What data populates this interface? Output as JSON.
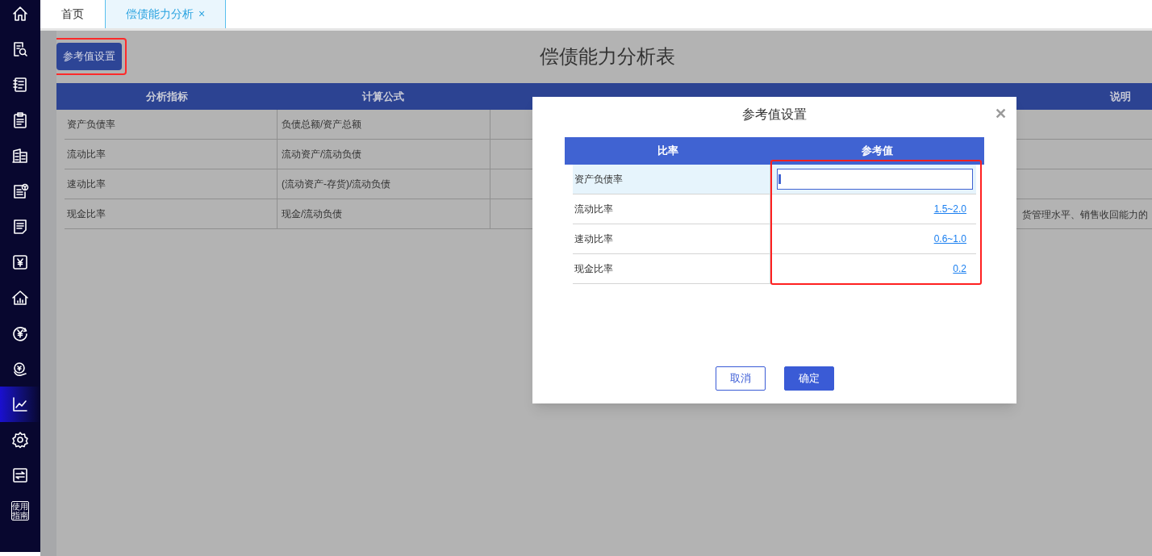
{
  "sidebar": {
    "items": [
      {
        "kind": "home",
        "selected": false
      },
      {
        "kind": "doc-search",
        "selected": false
      },
      {
        "kind": "list",
        "selected": false
      },
      {
        "kind": "clipboard",
        "selected": false
      },
      {
        "kind": "building",
        "selected": false
      },
      {
        "kind": "doc-yen",
        "selected": false
      },
      {
        "kind": "document",
        "selected": false
      },
      {
        "kind": "yen-square",
        "selected": false
      },
      {
        "kind": "house",
        "selected": false
      },
      {
        "kind": "yen-circle",
        "selected": false
      },
      {
        "kind": "coin",
        "selected": false
      },
      {
        "kind": "chart",
        "selected": true
      },
      {
        "kind": "gear",
        "selected": false
      },
      {
        "kind": "exchange",
        "selected": false
      },
      {
        "kind": "guide",
        "selected": false,
        "label": "使用指南"
      }
    ]
  },
  "tabs": [
    {
      "label": "首页",
      "selected": false
    },
    {
      "label": "偿债能力分析",
      "selected": true,
      "close": "×"
    }
  ],
  "toolbar": {
    "button": "参考值设置",
    "highlighted": true
  },
  "page_title": "偿债能力分析表",
  "table": {
    "columns": [
      "分析指标",
      "计算公式",
      "说明"
    ],
    "rows": [
      {
        "cells": [
          "资产负债率",
          "负债总额/资产总额"
        ]
      },
      {
        "cells": [
          "流动比率",
          "流动资产/流动负债"
        ]
      },
      {
        "cells": [
          "速动比率",
          "(流动资产-存货)/流动负债"
        ]
      },
      {
        "cells": [
          "现金比率",
          "现金/流动负债"
        ],
        "note": "货管理水平、销售收回能力的"
      }
    ]
  },
  "dialog": {
    "title": "参考值设置",
    "close": "✕",
    "columns": [
      "比率",
      "参考值"
    ],
    "rows": [
      {
        "ratio": "资产负债率",
        "kind": "input",
        "selected": true
      },
      {
        "ratio": "流动比率",
        "kind": "link",
        "value": "1.5~2.0",
        "selected": false
      },
      {
        "ratio": "速动比率",
        "kind": "link",
        "value": "0.6~1.0",
        "selected": false
      },
      {
        "ratio": "现金比率",
        "kind": "link",
        "value": "0.2",
        "selected": false
      }
    ],
    "highlighted": true,
    "buttons": [
      {
        "label": "取消",
        "kind": "secondary"
      },
      {
        "label": "确定",
        "kind": "primary"
      }
    ]
  }
}
